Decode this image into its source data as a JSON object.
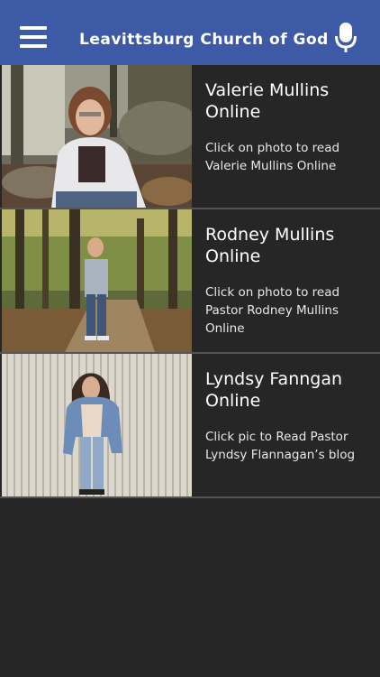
{
  "header": {
    "title": "Leavittsburg Church of God",
    "menu_icon": "hamburger-menu-icon",
    "mic_icon": "microphone-icon",
    "background": "#3d5aa6"
  },
  "items": [
    {
      "name": "Valerie Mullins Online",
      "description": "Click on photo to read Valerie Mullins Online",
      "photo": "woman seated on rocks in white hoodie"
    },
    {
      "name": "Rodney Mullins Online",
      "description": "Click on photo to read Pastor Rodney Mullins Online",
      "photo": "man standing on wooded trail"
    },
    {
      "name": "Lyndsy Fanngan Online",
      "description": "Click pic to Read Pastor Lyndsy Flannagan’s blog",
      "photo": "woman in denim jacket against metal wall"
    }
  ]
}
